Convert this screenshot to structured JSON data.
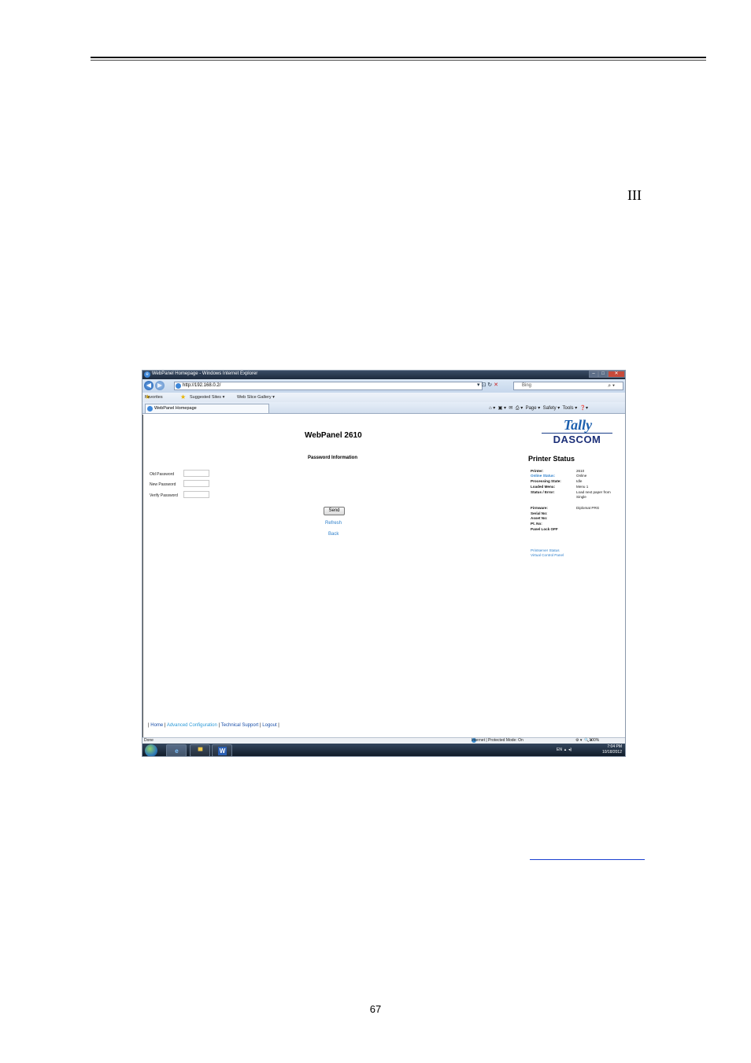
{
  "document": {
    "roman_numeral": "III",
    "page_number": "67"
  },
  "browser": {
    "window_title": "WebPanel Homepage - Windows Internet Explorer",
    "address": "http://192.168.0.2/",
    "search_placeholder": "Bing",
    "favorites_label": "Favorites",
    "suggested_sites": "Suggested Sites ▾",
    "web_slice_gallery": "Web Slice Gallery ▾",
    "tab_title": "WebPanel Homepage",
    "commands": {
      "page": "Page ▾",
      "safety": "Safety ▾",
      "tools": "Tools ▾"
    },
    "status_left": "Done",
    "status_zone": "Internet | Protected Mode: On",
    "zoom": "100%"
  },
  "webpanel": {
    "title": "WebPanel 2610",
    "password_heading": "Password Information",
    "fields": [
      {
        "label": "Old Password"
      },
      {
        "label": "New Password"
      },
      {
        "label": "Verify Password"
      }
    ],
    "send_label": "Send",
    "refresh_label": "Refresh",
    "back_label": "Back",
    "logo_tally": "Tally",
    "logo_dascom": "DASCOM",
    "printer_status_title": "Printer Status",
    "status_rows": [
      {
        "label": "Printer:",
        "value": "2610"
      },
      {
        "label": "Online Status:",
        "value": "Online"
      },
      {
        "label": "Processing State:",
        "value": "Idle"
      },
      {
        "label": "Loaded Menu:",
        "value": "Menu 1"
      },
      {
        "label": "Status / Error:",
        "value": "Load next paper from"
      },
      {
        "label": "",
        "value": "Single"
      }
    ],
    "detail_rows": [
      {
        "label": "Firmware:",
        "value": "Diplomat PRG"
      },
      {
        "label": "Serial No:",
        "value": ""
      },
      {
        "label": "Asset No:",
        "value": ""
      },
      {
        "label": "Pt. No:",
        "value": ""
      },
      {
        "label": "Panel Lock OFF",
        "value": ""
      }
    ],
    "printserver_status": "Printserver Status",
    "virtual_control_panel": "Virtual Control Panel",
    "footer": {
      "sep_open": "| ",
      "home": "Home",
      "sep1": " | ",
      "advanced": "Advanced Configuration",
      "sep2": " | ",
      "support": "Technical Support",
      "sep3": " | ",
      "logout": "Logout",
      "sep_close": " |"
    }
  },
  "taskbar": {
    "language": "EN",
    "time": "7:04 PM",
    "date": "10/18/2012"
  }
}
